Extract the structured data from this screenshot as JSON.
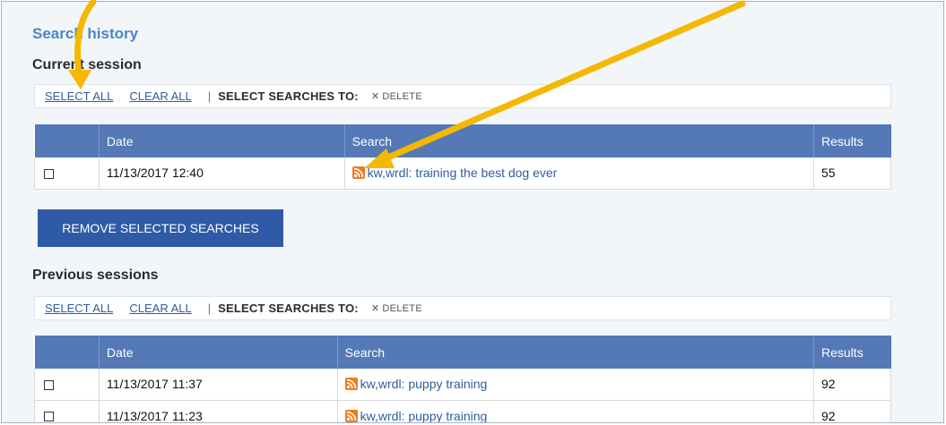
{
  "page": {
    "title": "Search history"
  },
  "current_session": {
    "heading": "Current session",
    "toolbar": {
      "select_all": "SELECT ALL",
      "clear_all": "CLEAR ALL",
      "separator": "|",
      "select_searches_to": "SELECT SEARCHES TO:",
      "delete_label": "DELETE"
    },
    "columns": [
      "Date",
      "Search",
      "Results"
    ],
    "rows": [
      {
        "date": "11/13/2017 12:40",
        "search": "kw,wrdl: training the best dog ever",
        "results": "55"
      }
    ],
    "remove_button": "REMOVE SELECTED SEARCHES"
  },
  "previous_sessions": {
    "heading": "Previous sessions",
    "toolbar": {
      "select_all": "SELECT ALL",
      "clear_all": "CLEAR ALL",
      "separator": "|",
      "select_searches_to": "SELECT SEARCHES TO:",
      "delete_label": "DELETE"
    },
    "columns": [
      "Date",
      "Search",
      "Results"
    ],
    "rows": [
      {
        "date": "11/13/2017 11:37",
        "search": "kw,wrdl: puppy training",
        "results": "92"
      },
      {
        "date": "11/13/2017 11:23",
        "search": "kw,wrdl: puppy training",
        "results": "92"
      }
    ]
  },
  "icons": {
    "rss": "rss-feed-icon",
    "delete": "close-x-icon",
    "checkbox": "checkbox"
  },
  "colors": {
    "header": "#5579b7",
    "button": "#2f5aa6",
    "link": "#2f5d9e",
    "title": "#4a86c5",
    "arrow": "#f5b800",
    "rss": "#f07a1e"
  }
}
